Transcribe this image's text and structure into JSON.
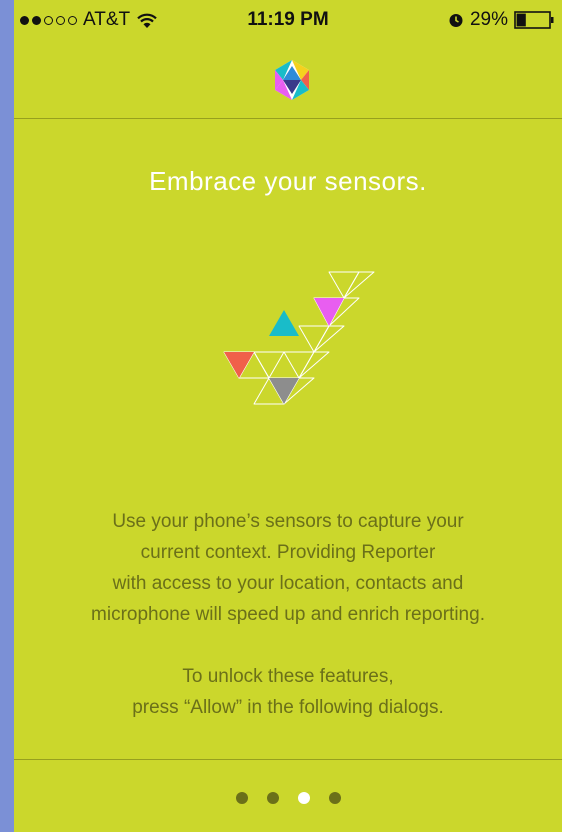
{
  "status_bar": {
    "signal_filled": 2,
    "signal_total": 5,
    "carrier": "AT&T",
    "time": "11:19 PM",
    "battery_percent": "29%",
    "battery_level": 0.29,
    "icons": [
      "wifi-icon",
      "alarm-icon",
      "battery-icon"
    ]
  },
  "logo": {
    "icon": "reporter-logo-icon"
  },
  "onboarding": {
    "headline": "Embrace your sensors.",
    "illustration": "checkmark-triangles-icon",
    "description_lines": [
      "Use your phone’s sensors to capture your",
      "current context. Providing Reporter",
      "with access to your location, contacts and",
      "microphone will speed up and enrich reporting."
    ],
    "instruction_lines": [
      "To unlock these features,",
      "press “Allow” in the following dialogs."
    ]
  },
  "pager": {
    "total": 4,
    "active_index": 2
  },
  "colors": {
    "background": "#cbd72c",
    "headline": "#ffffff",
    "body_text": "#6b7019",
    "triangle_red": "#f0604a",
    "triangle_teal": "#19bcc9",
    "triangle_magenta": "#e85ef0",
    "triangle_gray": "#8d8d8d"
  }
}
